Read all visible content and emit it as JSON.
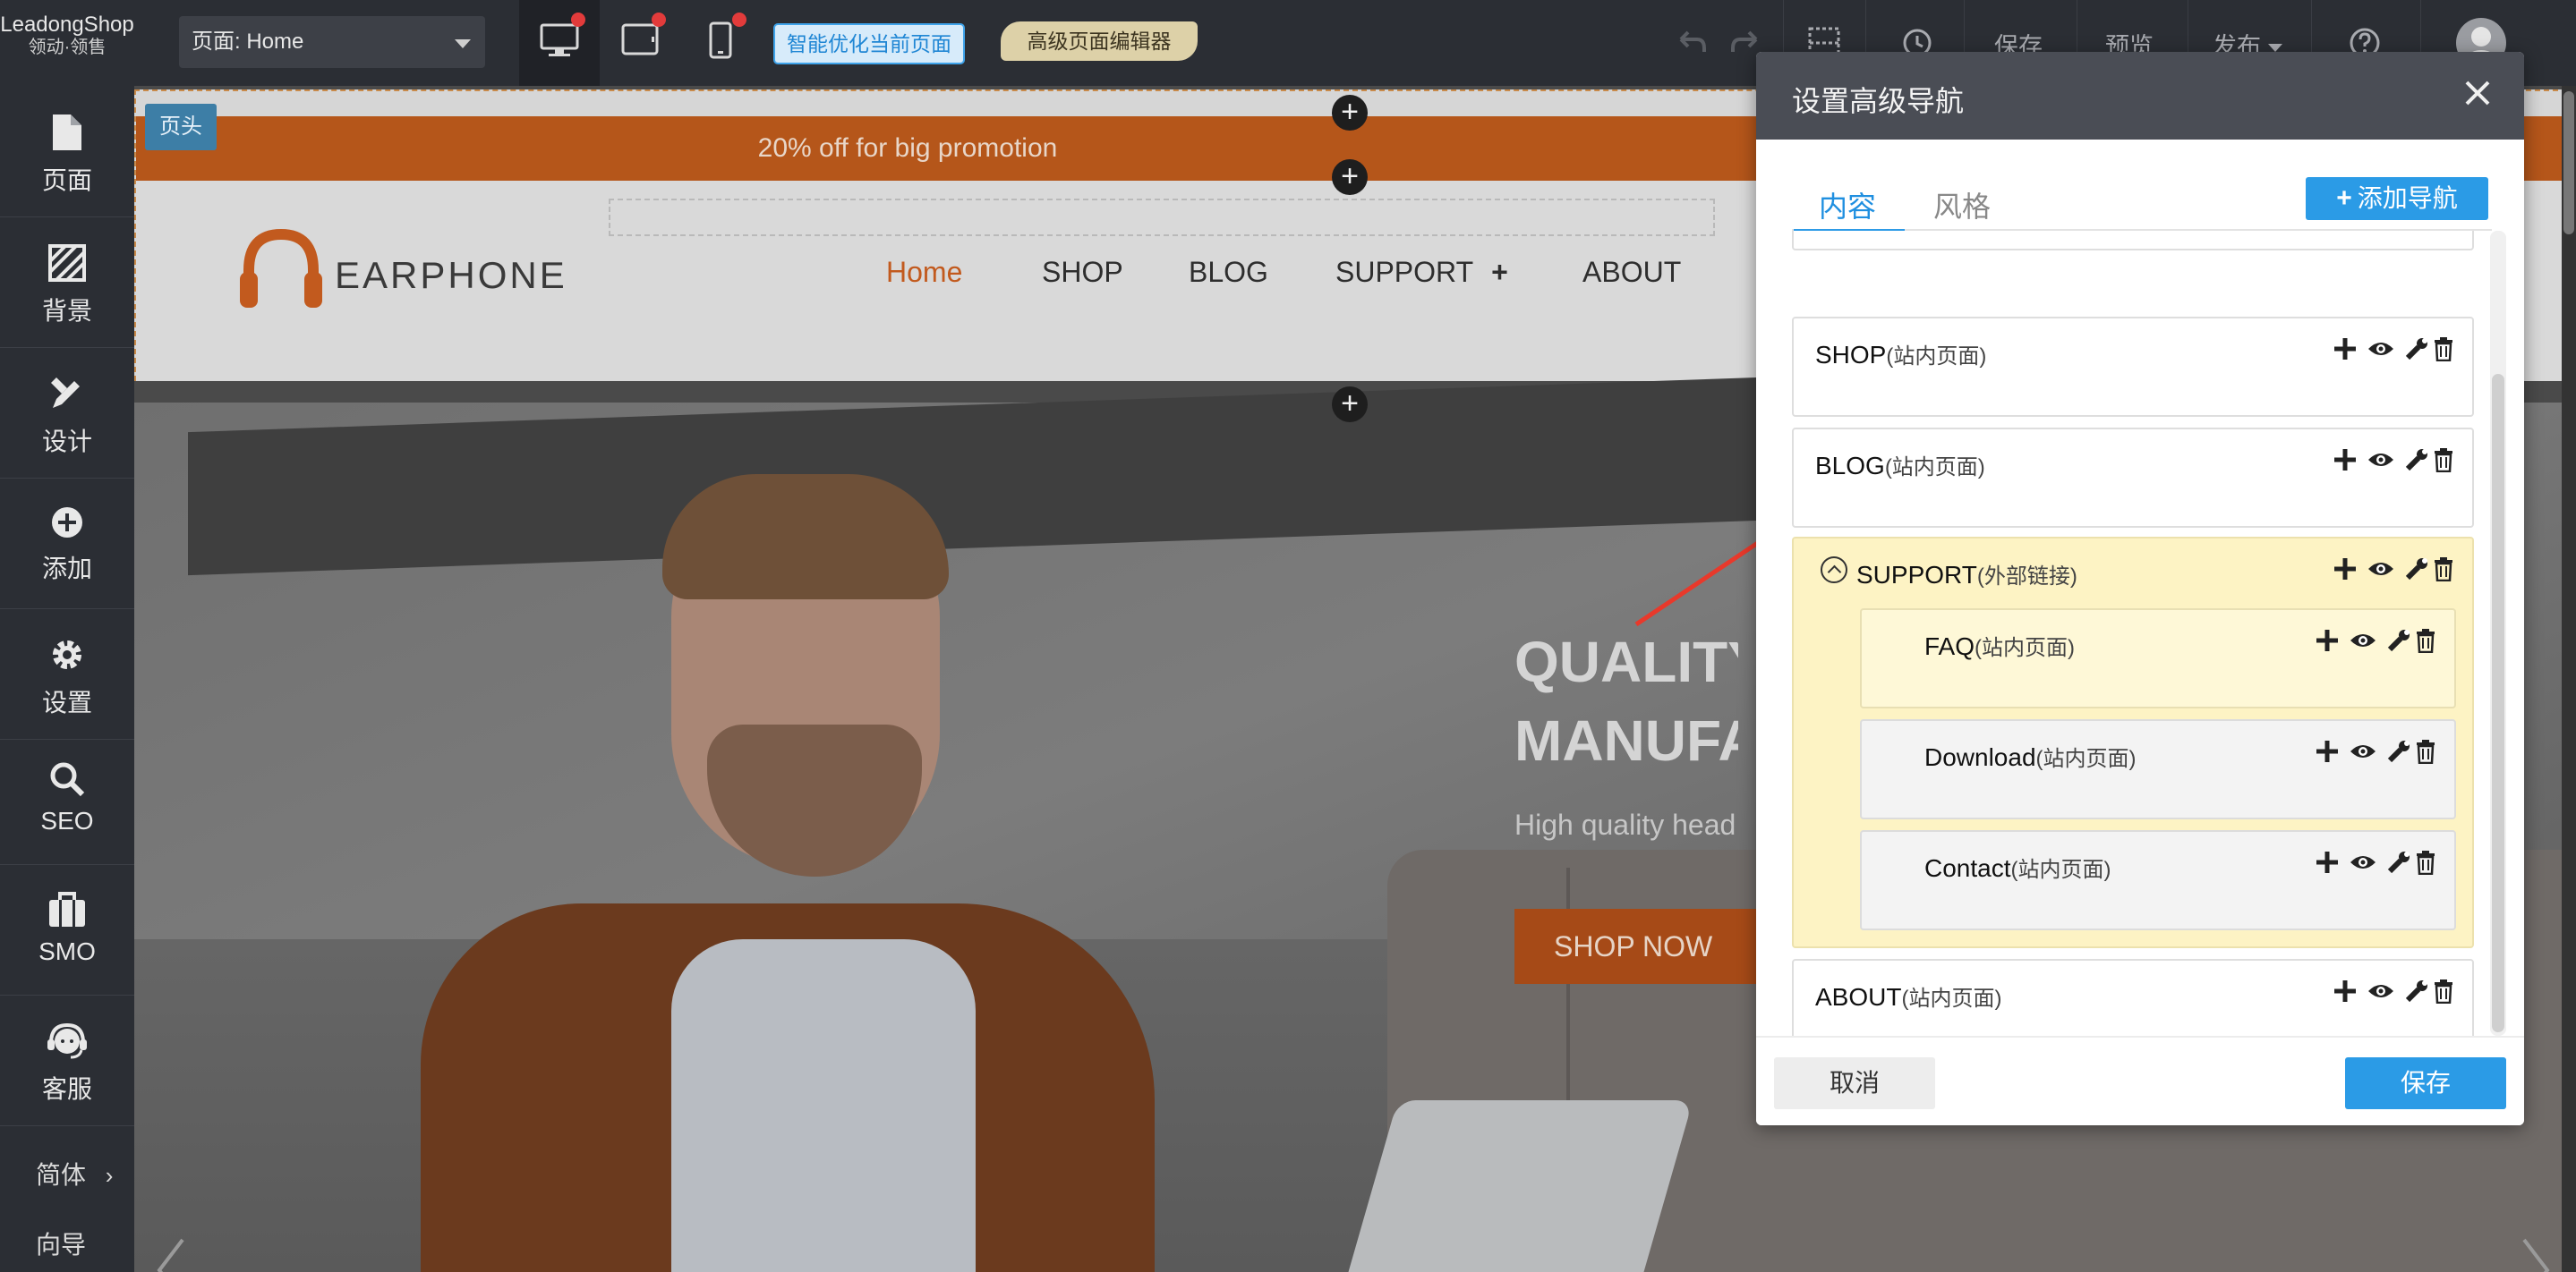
{
  "brand": {
    "name": "LeadongShop",
    "slogan": "领动·领售"
  },
  "toolbar": {
    "page_select_label": "页面: Home",
    "ai_optimize": "智能优化当前页面",
    "advanced_editor": "高级页面编辑器",
    "save": "保存",
    "preview": "预览",
    "publish": "发布"
  },
  "sidebar": {
    "items": [
      {
        "label": "页面",
        "icon": "file-icon"
      },
      {
        "label": "背景",
        "icon": "background-icon"
      },
      {
        "label": "设计",
        "icon": "design-icon"
      },
      {
        "label": "添加",
        "icon": "add-circle-icon"
      },
      {
        "label": "设置",
        "icon": "gear-icon"
      },
      {
        "label": "SEO",
        "icon": "search-icon"
      },
      {
        "label": "SMO",
        "icon": "briefcase-icon"
      },
      {
        "label": "客服",
        "icon": "headset-icon"
      }
    ],
    "language": "简体",
    "guide": "向导"
  },
  "canvas": {
    "header_tag": "页头",
    "promo_text": "20% off for big promotion",
    "logo_text": "EARPHONE",
    "nav": [
      "Home",
      "SHOP",
      "BLOG",
      "SUPPORT",
      "ABOUT"
    ],
    "hero_title_line1": "QUALITY",
    "hero_title_line2": "MANUFA",
    "hero_subtitle": "High quality head",
    "hero_button": "SHOP NOW"
  },
  "dialog": {
    "title": "设置高级导航",
    "tab_content": "内容",
    "tab_style": "风格",
    "add_nav": "添加导航",
    "items": [
      {
        "name": "SHOP",
        "type": "(站内页面)"
      },
      {
        "name": "BLOG",
        "type": "(站内页面)"
      },
      {
        "name": "SUPPORT",
        "type": "(外部链接)"
      },
      {
        "name": "FAQ",
        "type": "(站内页面)"
      },
      {
        "name": "Download",
        "type": "(站内页面)"
      },
      {
        "name": "Contact",
        "type": "(站内页面)"
      },
      {
        "name": "ABOUT",
        "type": "(站内页面)"
      }
    ],
    "cancel": "取消",
    "save": "保存"
  },
  "colors": {
    "accent": "#2b9be6",
    "brand_orange": "#c25a1e",
    "support_highlight": "#fdf3c4",
    "arrow_red": "#e8392b"
  }
}
